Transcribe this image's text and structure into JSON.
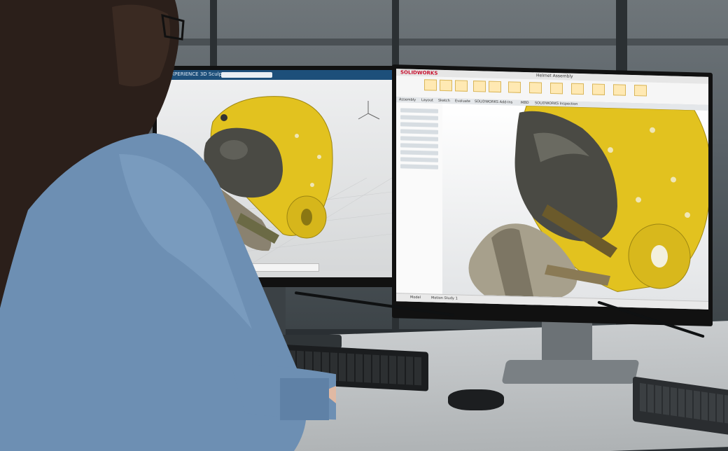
{
  "scene": {
    "description_tag": "",
    "left_monitor": {
      "app_name": "3DEXPERIENCE 3D Sculptor",
      "search_placeholder": ""
    },
    "right_monitor": {
      "app_logo": "SOLIDWORKS",
      "document_title": "Helmet Assembly",
      "tabs": [
        "Assembly",
        "Layout",
        "Sketch",
        "Evaluate",
        "SOLIDWORKS Add-Ins",
        "MBD",
        "SOLIDWORKS Inspection"
      ],
      "status_tabs": [
        "Model",
        "Motion Study 1"
      ]
    },
    "colors": {
      "helmet_yellow": "#e2c21f",
      "visor_dark": "#4a4a44",
      "shirt_blue": "#6d8fb3",
      "hair_dark": "#2b1f1a",
      "accent_red": "#c8102e"
    }
  }
}
